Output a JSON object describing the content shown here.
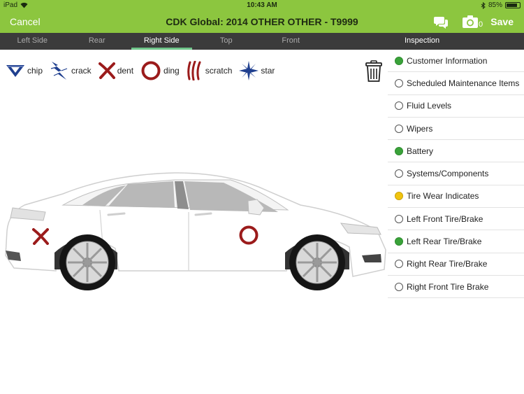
{
  "status_bar": {
    "device": "iPad",
    "time": "10:43 AM",
    "battery": "85%",
    "battery_level": 0.85
  },
  "nav": {
    "cancel": "Cancel",
    "title": "CDK Global: 2014 OTHER OTHER - T9999",
    "photo_count": "0",
    "save": "Save"
  },
  "tabs": [
    {
      "label": "Left Side",
      "active": false
    },
    {
      "label": "Rear",
      "active": false
    },
    {
      "label": "Right Side",
      "active": true
    },
    {
      "label": "Top",
      "active": false
    },
    {
      "label": "Front",
      "active": false
    }
  ],
  "legend": [
    {
      "label": "chip",
      "icon": "chip-icon",
      "color": "#1f3f8f"
    },
    {
      "label": "crack",
      "icon": "crack-icon",
      "color": "#1f3f8f"
    },
    {
      "label": "dent",
      "icon": "dent-icon",
      "color": "#9b1b1b"
    },
    {
      "label": "ding",
      "icon": "ding-icon",
      "color": "#9b1b1b"
    },
    {
      "label": "scratch",
      "icon": "scratch-icon",
      "color": "#9b1b1b"
    },
    {
      "label": "star",
      "icon": "star-icon",
      "color": "#1f3f8f"
    }
  ],
  "inspection": {
    "title": "Inspection",
    "items": [
      {
        "label": "Customer Information",
        "status": "green"
      },
      {
        "label": "Scheduled Maintenance Items",
        "status": "empty"
      },
      {
        "label": "Fluid Levels",
        "status": "empty"
      },
      {
        "label": "Wipers",
        "status": "empty"
      },
      {
        "label": "Battery",
        "status": "green"
      },
      {
        "label": "Systems/Components",
        "status": "empty"
      },
      {
        "label": "Tire Wear Indicates",
        "status": "yellow"
      },
      {
        "label": "Left Front  Tire/Brake",
        "status": "empty"
      },
      {
        "label": "Left Rear Tire/Brake",
        "status": "green"
      },
      {
        "label": "Right Rear Tire/Brake",
        "status": "empty"
      },
      {
        "label": "Right Front Tire Brake",
        "status": "empty"
      }
    ]
  },
  "colors": {
    "accent": "#8cc63f",
    "tabbar": "#3b3b3b",
    "active_tab_underline": "#6fc58a",
    "damage_red": "#9b1b1b",
    "damage_blue": "#1f3f8f"
  }
}
